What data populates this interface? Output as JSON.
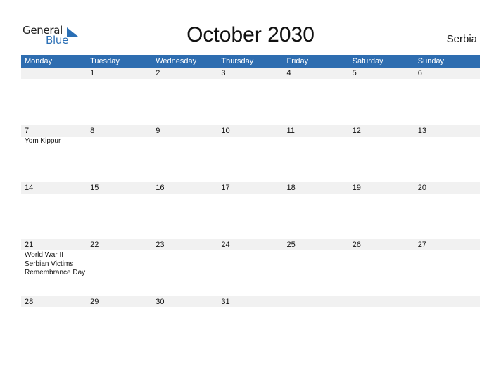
{
  "logo": {
    "part1": "General",
    "part2": "Blue"
  },
  "title": "October 2030",
  "country": "Serbia",
  "weekdays": [
    "Monday",
    "Tuesday",
    "Wednesday",
    "Thursday",
    "Friday",
    "Saturday",
    "Sunday"
  ],
  "weeks": [
    {
      "days": [
        "",
        "1",
        "2",
        "3",
        "4",
        "5",
        "6"
      ],
      "events": [
        "",
        "",
        "",
        "",
        "",
        "",
        ""
      ]
    },
    {
      "days": [
        "7",
        "8",
        "9",
        "10",
        "11",
        "12",
        "13"
      ],
      "events": [
        "Yom Kippur",
        "",
        "",
        "",
        "",
        "",
        ""
      ]
    },
    {
      "days": [
        "14",
        "15",
        "16",
        "17",
        "18",
        "19",
        "20"
      ],
      "events": [
        "",
        "",
        "",
        "",
        "",
        "",
        ""
      ]
    },
    {
      "days": [
        "21",
        "22",
        "23",
        "24",
        "25",
        "26",
        "27"
      ],
      "events": [
        "World War II Serbian Victims Remembrance Day",
        "",
        "",
        "",
        "",
        "",
        ""
      ]
    },
    {
      "days": [
        "28",
        "29",
        "30",
        "31",
        "",
        "",
        ""
      ],
      "events": [
        "",
        "",
        "",
        "",
        "",
        "",
        ""
      ]
    }
  ],
  "event_lines": {
    "w3d0": [
      "World War II",
      "Serbian Victims",
      "Remembrance Day"
    ]
  }
}
